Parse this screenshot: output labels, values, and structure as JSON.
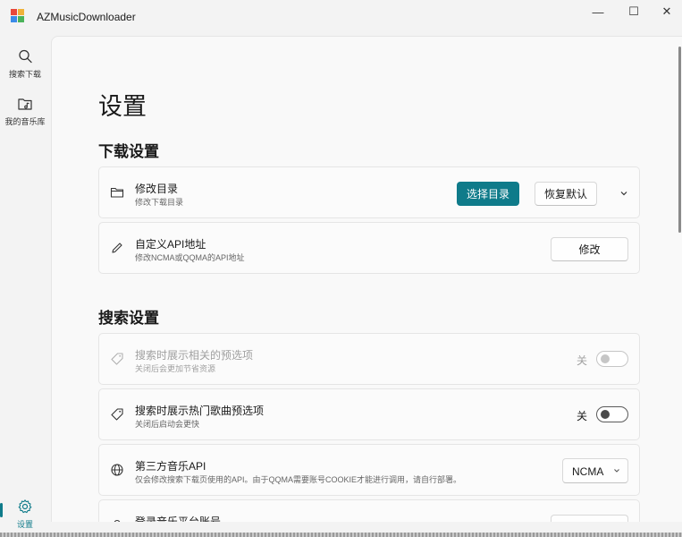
{
  "app": {
    "title": "AZMusicDownloader"
  },
  "window_controls": {
    "minimize": "—",
    "maximize": "☐",
    "close": "✕"
  },
  "nav": {
    "items": [
      {
        "label": "搜索下载",
        "icon": "search-icon"
      },
      {
        "label": "我的音乐库",
        "icon": "music-folder-icon"
      }
    ],
    "settings": {
      "label": "设置",
      "icon": "gear-icon"
    }
  },
  "page": {
    "title": "设置"
  },
  "download_section": {
    "title": "下载设置",
    "folder_card": {
      "icon": "folder-icon",
      "title": "修改目录",
      "subtitle": "修改下载目录",
      "choose_label": "选择目录",
      "reset_label": "恢复默认"
    },
    "api_card": {
      "icon": "pencil-icon",
      "title": "自定义API地址",
      "subtitle": "修改NCMA或QQMA的API地址",
      "button_label": "修改"
    }
  },
  "search_section": {
    "title": "搜索设置",
    "related_card": {
      "icon": "tag-icon",
      "title": "搜索时展示相关的预选项",
      "subtitle": "关闭后会更加节省资源",
      "state": "关",
      "enabled": false
    },
    "hot_card": {
      "icon": "tag-icon",
      "title": "搜索时展示热门歌曲预选项",
      "subtitle": "关闭后启动会更快",
      "state": "关",
      "enabled": true
    },
    "api_card": {
      "icon": "globe-icon",
      "title": "第三方音乐API",
      "subtitle": "仅会修改搜索下载页使用的API。由于QQMA需要账号COOKIE才能进行调用，请自行部署。",
      "selected": "NCMA"
    },
    "login_card": {
      "title": "登录音乐平台账号"
    }
  },
  "colors": {
    "accent": "#0f7b8a",
    "background": "#f3f3f3",
    "card": "#fbfbfb"
  }
}
